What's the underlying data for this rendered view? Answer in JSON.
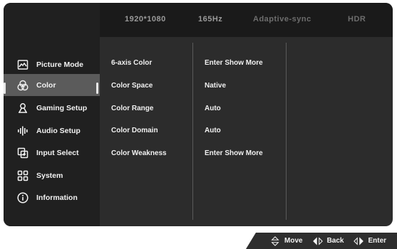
{
  "header": {
    "resolution": "1920*1080",
    "refresh_rate": "165Hz",
    "adaptive_sync": "Adaptive-sync",
    "hdr": "HDR"
  },
  "sidebar": {
    "items": [
      {
        "label": "Picture Mode",
        "icon": "picture-icon"
      },
      {
        "label": "Color",
        "icon": "color-circles-icon"
      },
      {
        "label": "Gaming Setup",
        "icon": "gaming-icon"
      },
      {
        "label": "Audio Setup",
        "icon": "audio-bars-icon"
      },
      {
        "label": "Input Select",
        "icon": "input-icon"
      },
      {
        "label": "System",
        "icon": "system-grid-icon"
      },
      {
        "label": "Information",
        "icon": "info-icon"
      }
    ],
    "selected_index": 1
  },
  "settings": [
    {
      "label": "6-axis Color",
      "value": "Enter Show More"
    },
    {
      "label": "Color Space",
      "value": "Native"
    },
    {
      "label": "Color Range",
      "value": "Auto"
    },
    {
      "label": "Color Domain",
      "value": "Auto"
    },
    {
      "label": "Color Weakness",
      "value": "Enter Show More"
    }
  ],
  "footer": {
    "move": "Move",
    "back": "Back",
    "enter": "Enter"
  },
  "colors": {
    "panel": "#2c2c2c",
    "sidebar": "#202020",
    "selected": "#5b5b5b",
    "text": "#f0f0f0"
  }
}
